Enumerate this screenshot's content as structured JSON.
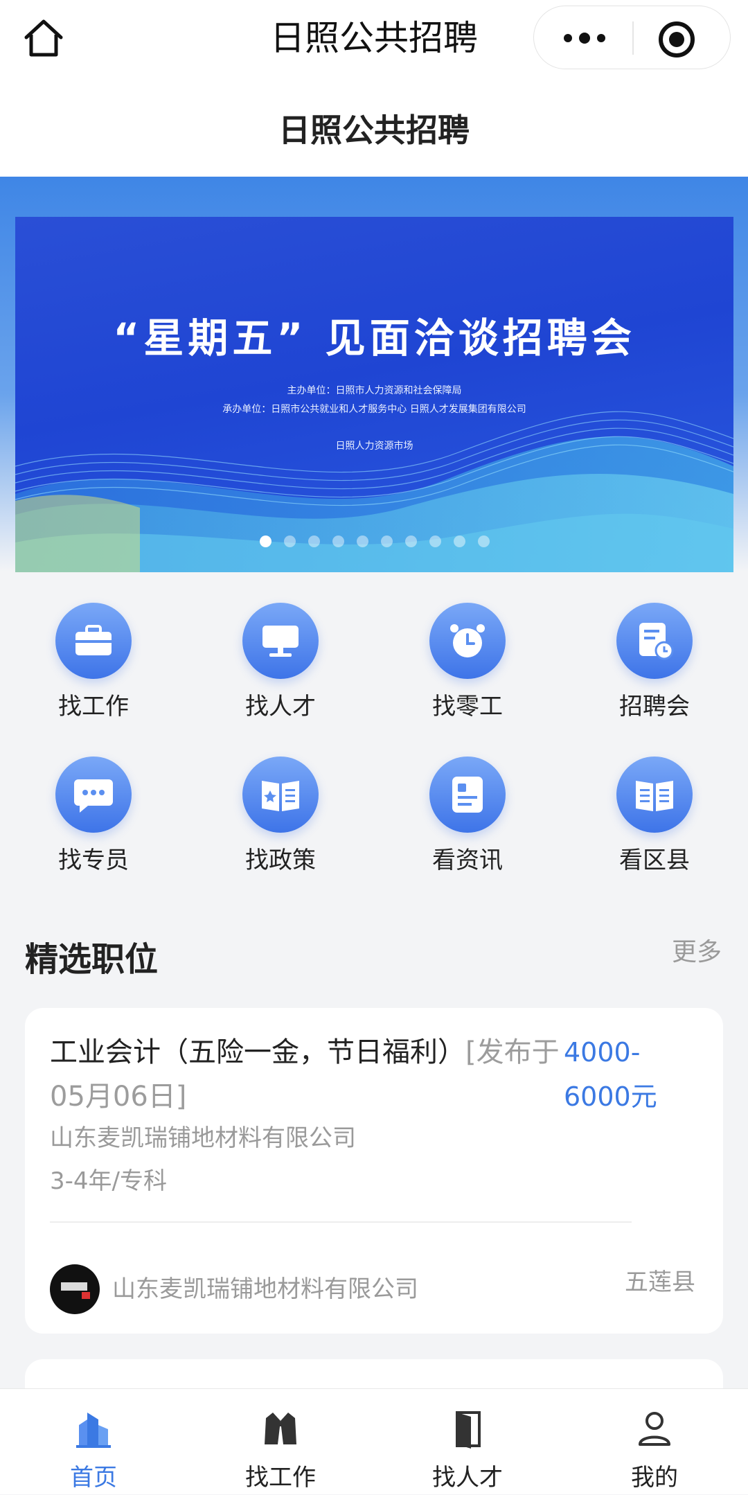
{
  "header": {
    "app_title": "日照公共招聘",
    "page_title": "日照公共招聘"
  },
  "banner": {
    "title": "“星期五” 见面洽谈招聘会",
    "organizer": "主办单位：日照市人力资源和社会保障局",
    "co_organizer": "承办单位：日照市公共就业和人才服务中心   日照人才发展集团有限公司",
    "venue": "日照人力资源市场",
    "slide_count": 10,
    "active_index": 0
  },
  "grid": {
    "items": [
      {
        "label": "找工作",
        "icon": "briefcase-icon"
      },
      {
        "label": "找人才",
        "icon": "monitor-icon"
      },
      {
        "label": "找零工",
        "icon": "alarm-clock-icon"
      },
      {
        "label": "招聘会",
        "icon": "document-clock-icon"
      },
      {
        "label": "找专员",
        "icon": "chat-bubble-icon"
      },
      {
        "label": "找政策",
        "icon": "policy-book-icon"
      },
      {
        "label": "看资讯",
        "icon": "news-icon"
      },
      {
        "label": "看区县",
        "icon": "open-book-icon"
      }
    ]
  },
  "featured": {
    "title": "精选职位",
    "more": "更多",
    "job": {
      "title": "工业会计（五险一金，节日福利）",
      "published": "[发布于05月06日]",
      "salary": "4000-6000元",
      "company": "山东麦凯瑞铺地材料有限公司",
      "requirement": "3-4年/专科",
      "footer_company": "山东麦凯瑞铺地材料有限公司",
      "region": "五莲县"
    }
  },
  "tabbar": {
    "items": [
      {
        "label": "首页",
        "icon": "home-building-icon",
        "active": true
      },
      {
        "label": "找工作",
        "icon": "suit-icon",
        "active": false
      },
      {
        "label": "找人才",
        "icon": "door-icon",
        "active": false
      },
      {
        "label": "我的",
        "icon": "user-icon",
        "active": false
      }
    ]
  },
  "colors": {
    "accent": "#3b79e3",
    "banner_blue": "#1f45d3",
    "muted_text": "#9a9a9a"
  }
}
